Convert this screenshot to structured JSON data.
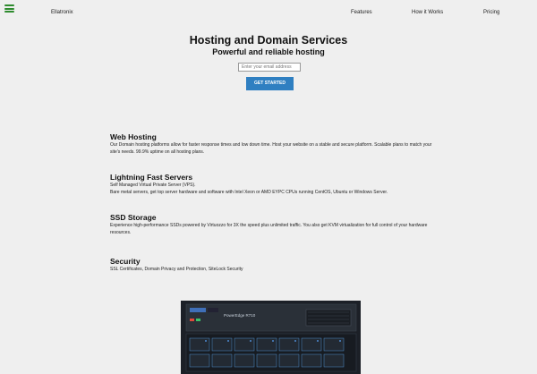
{
  "header": {
    "brand": "Ellatronix",
    "nav": [
      {
        "label": "Features"
      },
      {
        "label": "How it Works"
      },
      {
        "label": "Pricing"
      }
    ]
  },
  "hero": {
    "title": "Hosting and Domain Services",
    "subtitle": "Powerful and reliable hosting",
    "email_placeholder": "Enter your email address",
    "cta_label": "GET STARTED"
  },
  "features": [
    {
      "title": "Web Hosting",
      "lines": [
        "Our Domain hosting platforms allow for faster response times and low down time. Host your website on a stable and secure platform. Scalable plans to match your site's needs. 99.9% uptime on all hosting plans."
      ]
    },
    {
      "title": "Lightning Fast Servers",
      "lines": [
        "Self Managed Virtual Private Server (VPS).",
        "Bare metal servers, get top server hardware and software with Intel Xeon or AMD EYPC CPUs running CentOS, Ubuntu or Windows Server."
      ]
    },
    {
      "title": "SSD Storage",
      "lines": [
        "Experience high-performance SSDs powered by Virtuozzo for 3X the speed plus unlimited traffic. You also get KVM virtualization for full control of your hardware resources."
      ]
    },
    {
      "title": "Security",
      "lines": [
        "SSL Certificates, Domain Privacy and Protection, SiteLock Security"
      ]
    }
  ],
  "server_image": {
    "label": "PowerEdge R710"
  },
  "colors": {
    "background": "#efefef",
    "accent": "#2f7fc1",
    "menu_icon": "#2e8b2e"
  }
}
